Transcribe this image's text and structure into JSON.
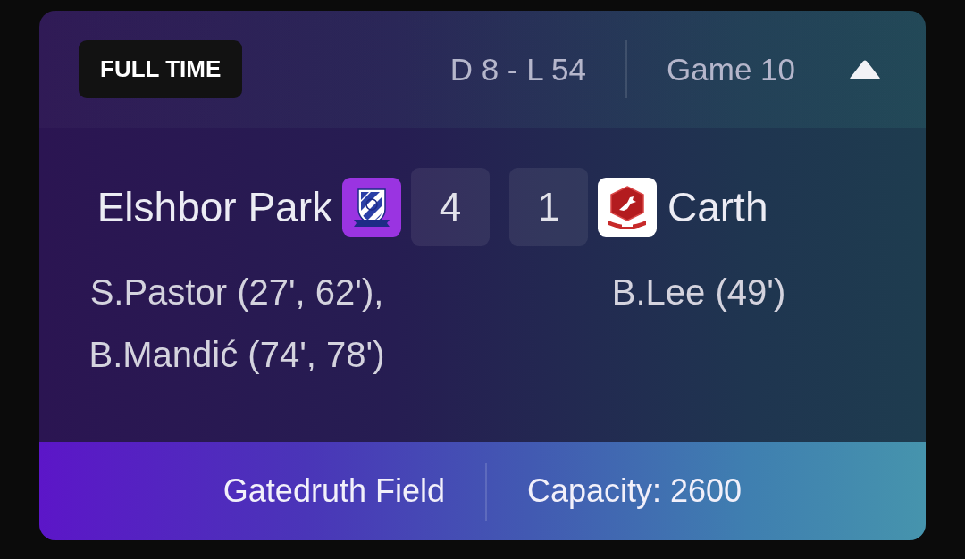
{
  "header": {
    "status_badge": "FULL TIME",
    "record": "D 8 - L 54",
    "game": "Game 10",
    "expanded": true
  },
  "home": {
    "name": "Elshbor Park",
    "score": "4",
    "scorers": [
      "S.Pastor (27', 62'),",
      "B.Mandić (74', 78')"
    ]
  },
  "away": {
    "name": "Carth",
    "score": "1",
    "scorers": [
      "B.Lee (49')"
    ]
  },
  "footer": {
    "venue": "Gatedruth Field",
    "capacity": "Capacity: 2600"
  }
}
